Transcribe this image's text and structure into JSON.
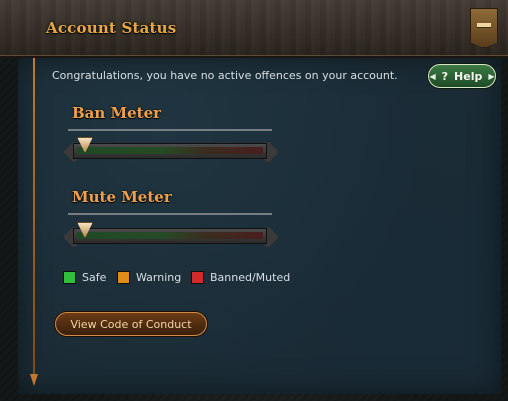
{
  "header": {
    "title": "Account Status"
  },
  "notice": {
    "text": "Congratulations, you have no active offences on your account."
  },
  "help_button": {
    "label": "Help",
    "icon": "question-icon"
  },
  "meters": [
    {
      "title": "Ban Meter",
      "level": 0.0
    },
    {
      "title": "Mute Meter",
      "level": 0.0
    }
  ],
  "legend": [
    {
      "label": "Safe",
      "color": "#2fbf3a"
    },
    {
      "label": "Warning",
      "color": "#e08c1a"
    },
    {
      "label": "Banned/Muted",
      "color": "#d12a2a"
    }
  ],
  "code_of_conduct_button": {
    "label": "View Code of Conduct"
  },
  "colors": {
    "accent_orange": "#e7a745",
    "panel_bg": "#1b2c36",
    "help_green": "#2f6f3a"
  }
}
